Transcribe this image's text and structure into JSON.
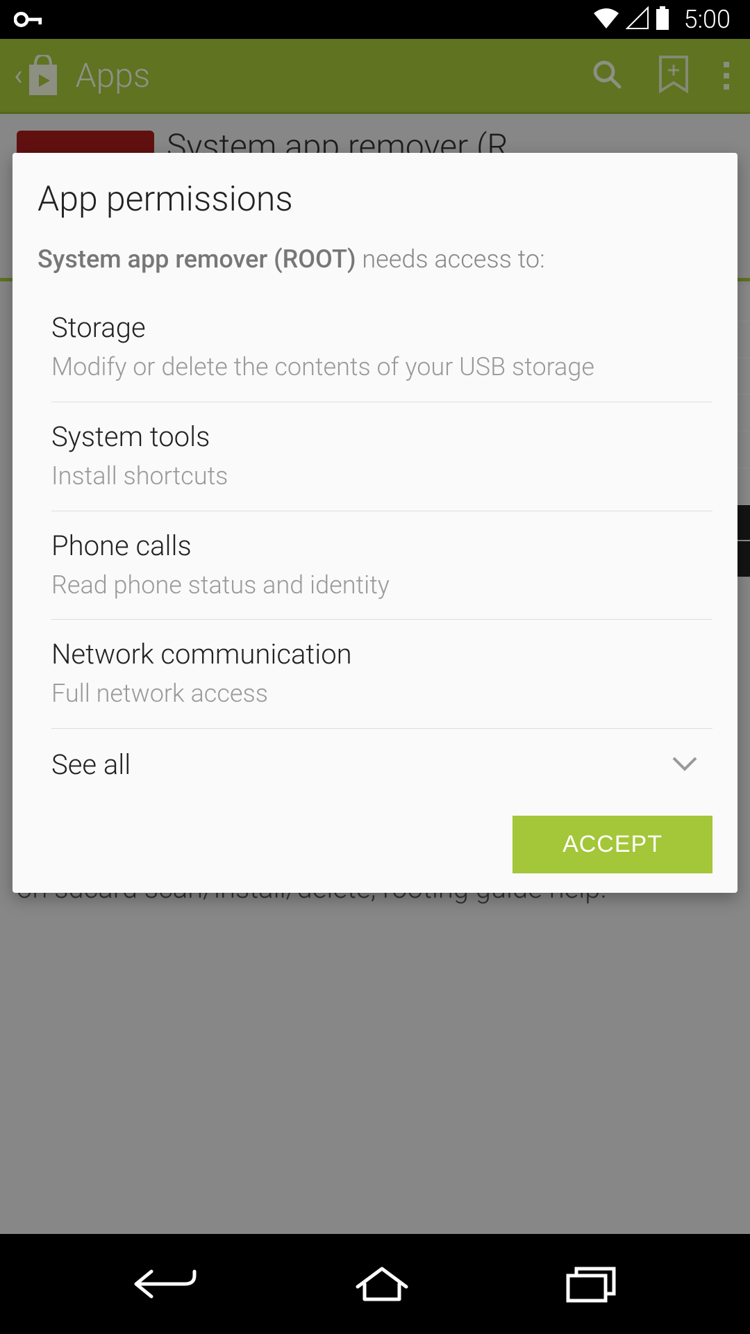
{
  "status_bar": {
    "time": "5:00"
  },
  "action_bar": {
    "title": "Apps"
  },
  "behind": {
    "app_title": "System app remover (R..",
    "description": "We provide not only system app remover, but also user app uninstaller, move app to sdcard, move app to phone, apk on sdcard scan/install/delete, rooting guide help."
  },
  "dialog": {
    "title": "App permissions",
    "subtitle_prefix": "System app remover (ROOT)",
    "subtitle_suffix": " needs access to:",
    "permissions": [
      {
        "name": "Storage",
        "desc": "Modify or delete the contents of your USB storage"
      },
      {
        "name": "System tools",
        "desc": "Install shortcuts"
      },
      {
        "name": "Phone calls",
        "desc": "Read phone status and identity"
      },
      {
        "name": "Network communication",
        "desc": "Full network access"
      }
    ],
    "see_all": "See all",
    "accept_label": "ACCEPT"
  }
}
